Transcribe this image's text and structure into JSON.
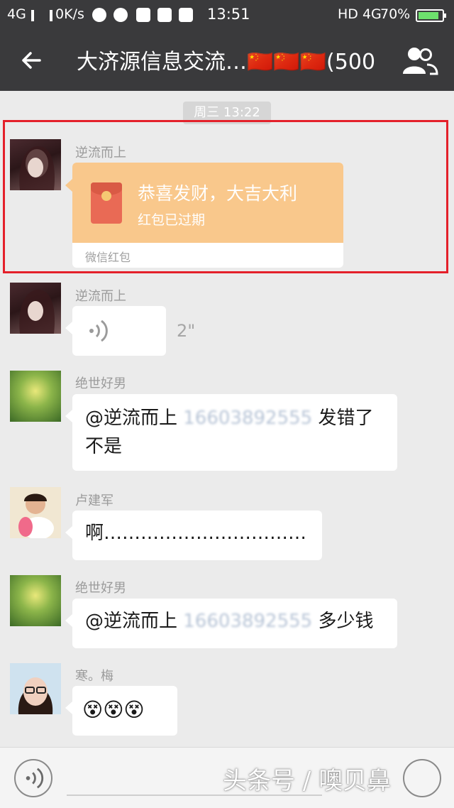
{
  "status_bar": {
    "network_left": "4G",
    "speed": "0K/s",
    "time": "13:51",
    "network_right": "HD 4G",
    "battery": "70%"
  },
  "title_bar": {
    "title": "大济源信息交流…🇨🇳🇨🇳🇨🇳(500"
  },
  "time_divider": "周三 13:22",
  "messages": [
    {
      "sender": "逆流而上",
      "type": "red_packet",
      "red_packet": {
        "greeting": "恭喜发财，大吉大利",
        "status": "红包已过期",
        "footer": "微信红包"
      }
    },
    {
      "sender": "逆流而上",
      "type": "voice",
      "duration": "2\""
    },
    {
      "sender": "绝世好男",
      "type": "text",
      "prefix": "@逆流而上 ",
      "blurred": "16603892555",
      "suffix": " 发错了",
      "line2": "不是"
    },
    {
      "sender": "卢建军",
      "type": "text",
      "text": "啊……………………………"
    },
    {
      "sender": "绝世好男",
      "type": "text",
      "prefix": "@逆流而上 ",
      "blurred": "16603892555",
      "suffix": " 多少钱"
    },
    {
      "sender": "寒。梅",
      "type": "emoji",
      "emojis": [
        "😵",
        "😵",
        "😵"
      ]
    }
  ],
  "watermark": "头条号 / 噢贝鼻",
  "icons": {
    "back": "arrow-left-icon",
    "group": "group-members-icon",
    "voice": "voice-wave-icon"
  }
}
